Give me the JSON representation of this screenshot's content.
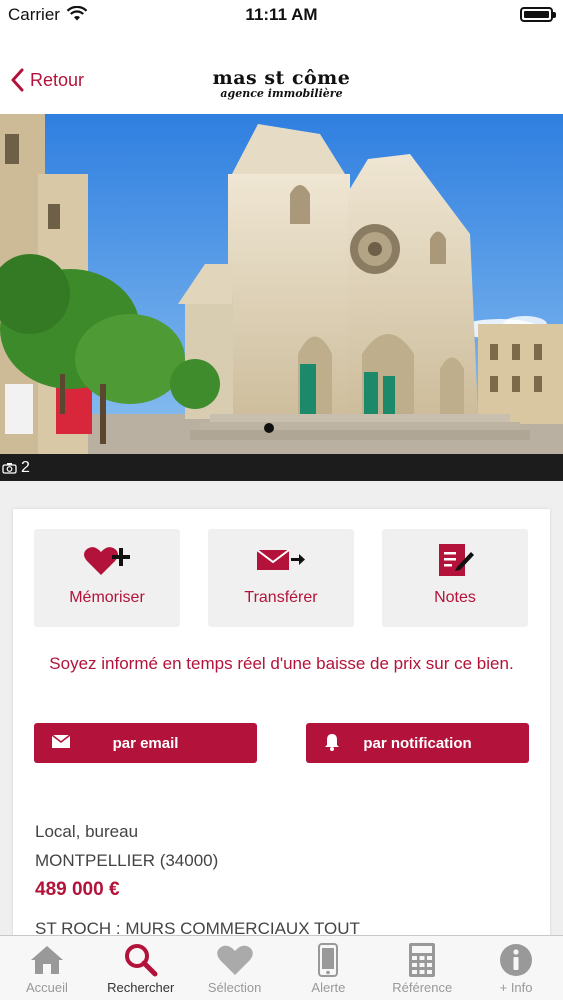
{
  "status_bar": {
    "carrier": "Carrier",
    "time": "11:11 AM"
  },
  "nav": {
    "back_label": "Retour",
    "logo_main": "mas st côme",
    "logo_sub": "agence immobilière"
  },
  "photo": {
    "count": "2"
  },
  "actions": [
    {
      "label": "Mémoriser",
      "icon": "heart-plus-icon"
    },
    {
      "label": "Transférer",
      "icon": "envelope-arrow-icon"
    },
    {
      "label": "Notes",
      "icon": "notes-pencil-icon"
    }
  ],
  "alert": {
    "text": "Soyez informé en temps réel d'une baisse de prix sur ce bien.",
    "email_label": "par email",
    "notification_label": "par notification"
  },
  "property": {
    "type": "Local, bureau",
    "city": "MONTPELLIER (34000)",
    "price": "489 000  €",
    "description": "ST ROCH : MURS COMMERCIAUX TOUT"
  },
  "tabs": [
    {
      "label": "Accueil",
      "icon": "home-icon",
      "active": false
    },
    {
      "label": "Rechercher",
      "icon": "search-icon",
      "active": true
    },
    {
      "label": "Sélection",
      "icon": "heart-icon",
      "active": false
    },
    {
      "label": "Alerte",
      "icon": "phone-icon",
      "active": false
    },
    {
      "label": "Référence",
      "icon": "calculator-icon",
      "active": false
    },
    {
      "label": "+ Info",
      "icon": "info-icon",
      "active": false
    }
  ],
  "colors": {
    "accent": "#b3133a",
    "tab_inactive": "#999999",
    "tab_active": "#333333"
  }
}
